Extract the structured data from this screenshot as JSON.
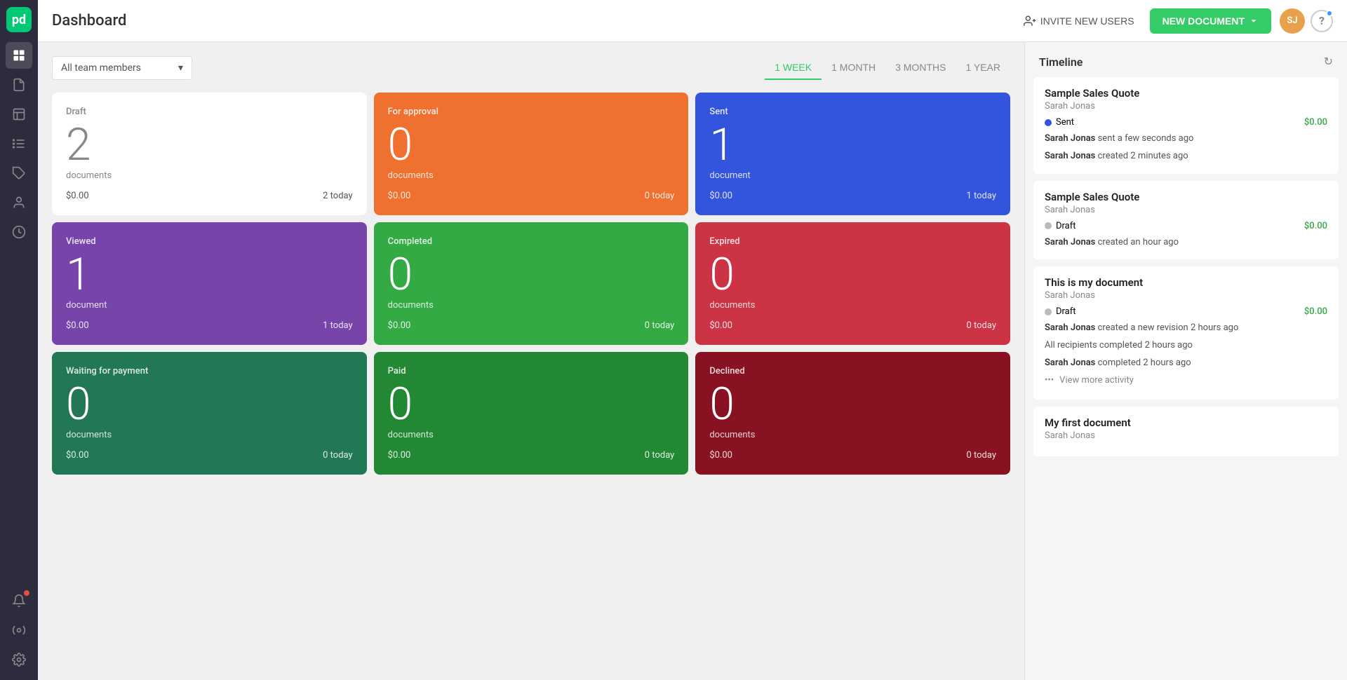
{
  "app": {
    "logo_text": "pd",
    "title": "Dashboard"
  },
  "topbar": {
    "invite_label": "INVITE NEW USERS",
    "new_doc_label": "NEW DOCUMENT",
    "avatar_initials": "SJ",
    "help_label": "?"
  },
  "filter": {
    "team_label": "All team members",
    "time_options": [
      {
        "label": "1 WEEK",
        "active": true
      },
      {
        "label": "1 MONTH",
        "active": false
      },
      {
        "label": "3 MONTHS",
        "active": false
      },
      {
        "label": "1 YEAR",
        "active": false
      }
    ]
  },
  "stats": [
    {
      "label": "Draft",
      "number": "2",
      "doc_label": "documents",
      "amount": "$0.00",
      "today": "2 today",
      "theme": "white"
    },
    {
      "label": "For approval",
      "number": "0",
      "doc_label": "documents",
      "amount": "$0.00",
      "today": "0 today",
      "theme": "orange"
    },
    {
      "label": "Sent",
      "number": "1",
      "doc_label": "document",
      "amount": "$0.00",
      "today": "1 today",
      "theme": "blue"
    },
    {
      "label": "Viewed",
      "number": "1",
      "doc_label": "document",
      "amount": "$0.00",
      "today": "1 today",
      "theme": "purple"
    },
    {
      "label": "Completed",
      "number": "0",
      "doc_label": "documents",
      "amount": "$0.00",
      "today": "0 today",
      "theme": "green"
    },
    {
      "label": "Expired",
      "number": "0",
      "doc_label": "documents",
      "amount": "$0.00",
      "today": "0 today",
      "theme": "red"
    },
    {
      "label": "Waiting for payment",
      "number": "0",
      "doc_label": "documents",
      "amount": "$0.00",
      "today": "0 today",
      "theme": "teal"
    },
    {
      "label": "Paid",
      "number": "0",
      "doc_label": "documents",
      "amount": "$0.00",
      "today": "0 today",
      "theme": "darkgreen"
    },
    {
      "label": "Declined",
      "number": "0",
      "doc_label": "documents",
      "amount": "$0.00",
      "today": "0 today",
      "theme": "darkred"
    }
  ],
  "timeline": {
    "title": "Timeline",
    "cards": [
      {
        "id": 1,
        "doc_title": "Sample Sales Quote",
        "author": "Sarah Jonas",
        "status_label": "Sent",
        "status_type": "blue",
        "amount": "$0.00",
        "activities": [
          {
            "actor": "Sarah Jonas",
            "action": "sent a few seconds ago"
          },
          {
            "actor": "Sarah Jonas",
            "action": "created 2 minutes ago"
          }
        ]
      },
      {
        "id": 2,
        "doc_title": "Sample Sales Quote",
        "author": "Sarah Jonas",
        "status_label": "Draft",
        "status_type": "gray",
        "amount": "$0.00",
        "activities": [
          {
            "actor": "Sarah Jonas",
            "action": "created an hour ago"
          }
        ]
      },
      {
        "id": 3,
        "doc_title": "This is my document",
        "author": "Sarah Jonas",
        "status_label": "Draft",
        "status_type": "gray",
        "amount": "$0.00",
        "activities": [
          {
            "actor": "Sarah Jonas",
            "action": "created a new revision 2 hours ago"
          },
          {
            "actor": null,
            "action": "All recipients completed 2 hours ago"
          },
          {
            "actor": "Sarah Jonas",
            "action": "completed 2 hours ago"
          }
        ],
        "view_more": "View more activity"
      },
      {
        "id": 4,
        "doc_title": "My first document",
        "author": "Sarah Jonas",
        "status_label": null,
        "amount": null,
        "activities": []
      }
    ]
  },
  "sidebar": {
    "items": [
      {
        "name": "dashboard",
        "label": "Dashboard"
      },
      {
        "name": "documents",
        "label": "Documents"
      },
      {
        "name": "templates",
        "label": "Templates"
      },
      {
        "name": "catalog",
        "label": "Catalog"
      },
      {
        "name": "tags",
        "label": "Tags"
      },
      {
        "name": "contacts",
        "label": "Contacts"
      },
      {
        "name": "reports",
        "label": "Reports"
      },
      {
        "name": "notifications",
        "label": "Notifications",
        "badge": true
      },
      {
        "name": "integrations",
        "label": "Integrations"
      },
      {
        "name": "settings",
        "label": "Settings"
      }
    ]
  }
}
